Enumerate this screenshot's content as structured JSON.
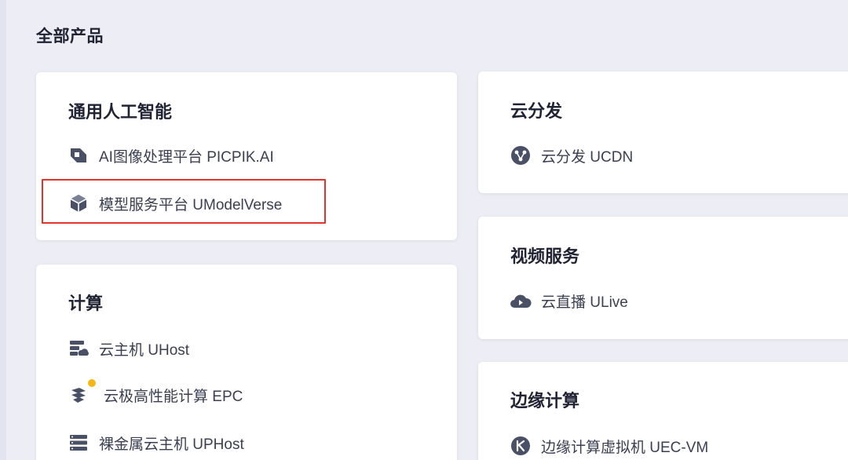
{
  "page": {
    "title": "全部产品"
  },
  "cards": {
    "general_ai": {
      "title": "通用人工智能",
      "items": [
        {
          "label": "AI图像处理平台 PICPIK.AI",
          "icon": "image-processing-icon"
        },
        {
          "label": "模型服务平台 UModelVerse",
          "icon": "cube-icon"
        }
      ]
    },
    "compute": {
      "title": "计算",
      "items": [
        {
          "label": "云主机 UHost",
          "icon": "server-cloud-icon"
        },
        {
          "label": "云极高性能计算 EPC",
          "icon": "hpc-icon"
        },
        {
          "label": "裸金属云主机 UPHost",
          "icon": "bare-metal-icon"
        }
      ]
    },
    "cdn": {
      "title": "云分发",
      "items": [
        {
          "label": "云分发 UCDN",
          "icon": "distribution-icon"
        }
      ]
    },
    "video": {
      "title": "视频服务",
      "items": [
        {
          "label": "云直播 ULive",
          "icon": "live-cloud-icon"
        }
      ]
    },
    "edge": {
      "title": "边缘计算",
      "items": [
        {
          "label": "边缘计算虚拟机 UEC-VM",
          "icon": "edge-vm-icon"
        }
      ]
    }
  },
  "colors": {
    "background": "#edeef5",
    "card": "#ffffff",
    "text": "#1f2333",
    "icon": "#4a5066",
    "highlight": "#e2342c",
    "badge": "#f5b716"
  }
}
